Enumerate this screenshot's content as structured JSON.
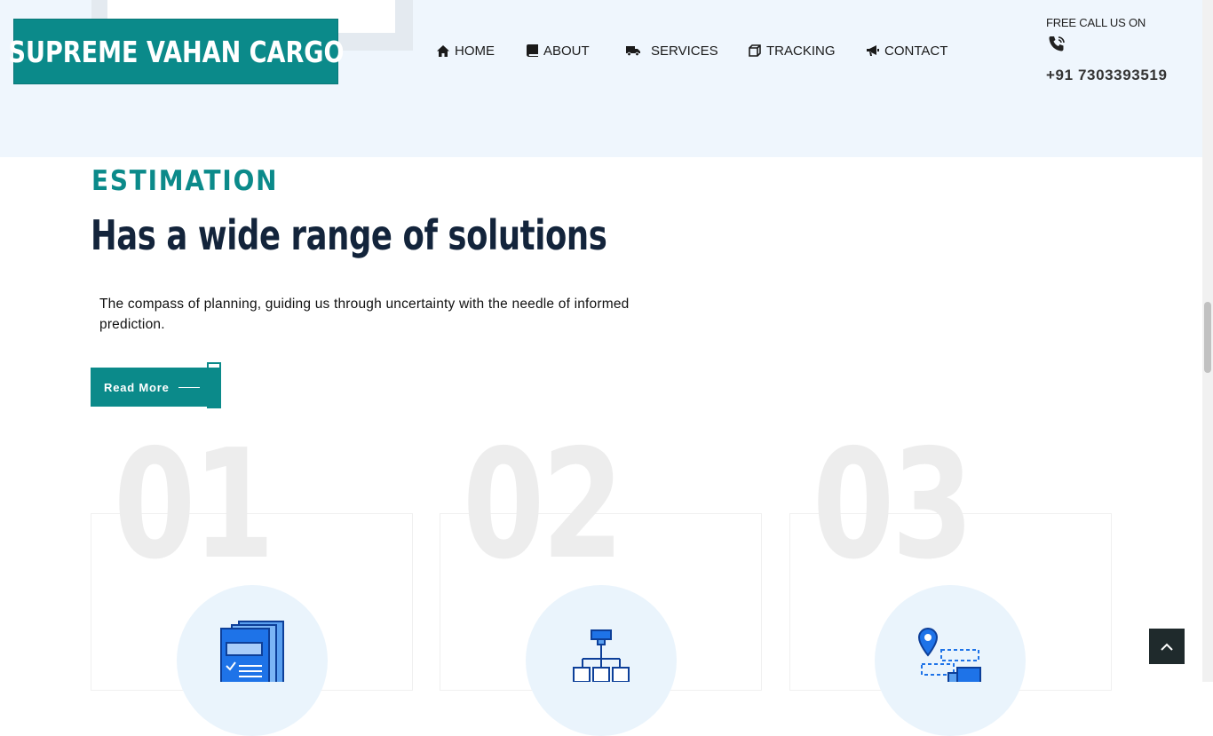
{
  "brand": {
    "logo_text": "SUPREME VAHAN CARGO"
  },
  "nav": {
    "items": [
      {
        "label": "HOME",
        "icon": "home-icon"
      },
      {
        "label": "ABOUT",
        "icon": "book-icon"
      },
      {
        "label": "SERVICES",
        "icon": "truck-icon"
      },
      {
        "label": "TRACKING",
        "icon": "box-icon"
      },
      {
        "label": "CONTACT",
        "icon": "megaphone-icon"
      }
    ]
  },
  "call": {
    "label": "FREE CALL US ON",
    "icon": "phone-icon",
    "number": "+91 7303393519"
  },
  "hero": {
    "eyebrow": "ESTIMATION",
    "title": "Has a wide range of solutions",
    "description": "The compass of planning, guiding us through uncertainty with the needle of informed prediction.",
    "button_label": "Read More"
  },
  "steps": [
    {
      "number": "01",
      "icon": "documents-icon"
    },
    {
      "number": "02",
      "icon": "hierarchy-icon"
    },
    {
      "number": "03",
      "icon": "location-route-icon"
    }
  ],
  "colors": {
    "accent": "#0b8a8a",
    "header_bg": "#eff6fd",
    "heading": "#13243b",
    "icon_blue": "#1e73e8"
  },
  "scroll_top_icon": "chevron-up-icon"
}
